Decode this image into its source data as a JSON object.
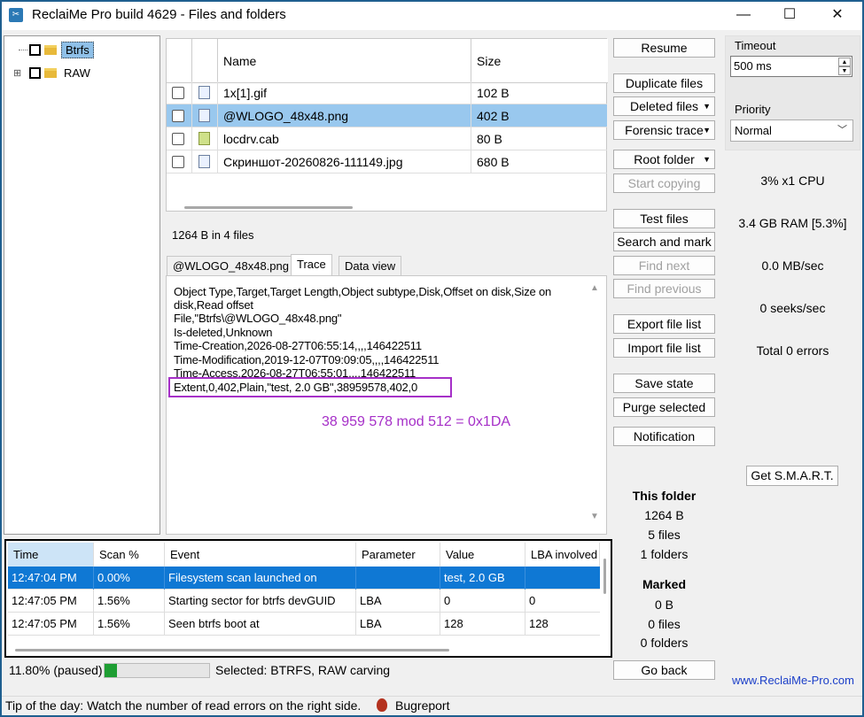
{
  "window": {
    "title": "ReclaiMe Pro build 4629 - Files and folders",
    "minimize": "—",
    "maximize": "☐",
    "close": "✕"
  },
  "tree": {
    "items": [
      {
        "label": "Btrfs",
        "expander": ""
      },
      {
        "label": "RAW",
        "expander": "⊞"
      }
    ]
  },
  "filelist": {
    "columns": [
      "Name",
      "Size"
    ],
    "rows": [
      {
        "name": "1x[1].gif",
        "size": "102 B"
      },
      {
        "name": "@WLOGO_48x48.png",
        "size": "402 B"
      },
      {
        "name": "locdrv.cab",
        "size": "80 B"
      },
      {
        "name": "Скриншот-20260826-111149.jpg",
        "size": "680 B"
      }
    ],
    "summary": "1264 B in 4 files"
  },
  "tabs": [
    "@WLOGO_48x48.png",
    "Trace",
    "Data view"
  ],
  "trace": {
    "lines": [
      "Object Type,Target,Target Length,Object subtype,Disk,Offset on disk,Size on",
      "disk,Read offset",
      "File,\"Btrfs\\@WLOGO_48x48.png\"",
      "Is-deleted,Unknown",
      "Time-Creation,2026-08-27T06:55:14,,,,146422511",
      "Time-Modification,2019-12-07T09:09:05,,,,146422511",
      "Time-Access,2026-08-27T06:55:01,,,,146422511",
      "Extent,0,402,Plain,\"test, 2.0 GB\",38959578,402,0"
    ],
    "annotation": "38 959 578 mod 512 = 0x1DA"
  },
  "buttons": {
    "resume": "Resume",
    "duplicate": "Duplicate files",
    "deleted": "Deleted files",
    "forensic": "Forensic trace",
    "root": "Root folder",
    "start_copying": "Start copying",
    "test_files": "Test files",
    "search_mark": "Search and mark",
    "find_next": "Find next",
    "find_previous": "Find previous",
    "export": "Export file list",
    "import": "Import file list",
    "save_state": "Save state",
    "purge": "Purge selected",
    "notification": "Notification",
    "go_back": "Go back",
    "smart": "Get S.M.A.R.T."
  },
  "settings": {
    "timeout_label": "Timeout",
    "timeout_value": "500 ms",
    "priority_label": "Priority",
    "priority_value": "Normal"
  },
  "stats": {
    "cpu": "3% x1 CPU",
    "ram": "3.4 GB RAM [5.3%]",
    "speed": "0.0 MB/sec",
    "seeks": "0 seeks/sec",
    "errors": "Total 0 errors"
  },
  "folder_stats": {
    "this_folder_title": "This folder",
    "this_size": "1264 B",
    "this_files": "5 files",
    "this_folders": "1 folders",
    "marked_title": "Marked",
    "marked_size": "0 B",
    "marked_files": "0 files",
    "marked_folders": "0 folders"
  },
  "log": {
    "columns": [
      "Time",
      "Scan %",
      "Event",
      "Parameter",
      "Value",
      "LBA involved"
    ],
    "rows": [
      [
        "12:47:04 PM",
        "0.00%",
        "Filesystem scan launched on",
        "",
        "test, 2.0 GB",
        ""
      ],
      [
        "12:47:05 PM",
        "1.56%",
        "Starting sector for btrfs devGUID",
        "LBA",
        "0",
        "0"
      ],
      [
        "12:47:05 PM",
        "1.56%",
        "Seen btrfs boot at",
        "LBA",
        "128",
        "128"
      ]
    ]
  },
  "progress": {
    "label": "11.80% (paused)",
    "fraction": 0.118,
    "selected": "Selected: BTRFS, RAW carving"
  },
  "footer": {
    "site": "www.ReclaiMe-Pro.com",
    "tip": "Tip of the day: Watch the number of read errors on the right side.",
    "bugreport": "Bugreport"
  },
  "colors": {
    "accent": "#0f78d4",
    "selection": "#99c8ee",
    "annotation": "#a630c8",
    "progress": "#1e9e33",
    "link": "#1a3ec8"
  }
}
